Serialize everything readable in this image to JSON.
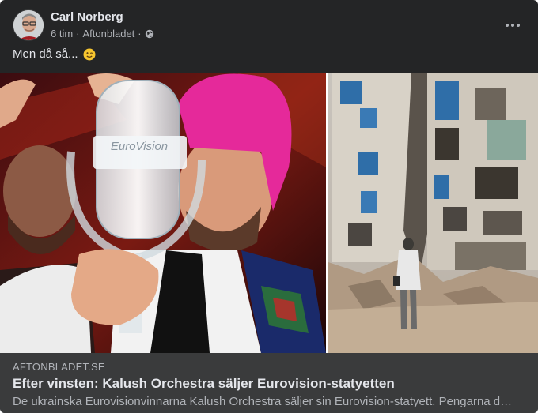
{
  "post": {
    "author": "Carl Norberg",
    "time": "6 tim",
    "source": "Aftonbladet",
    "separator": "·",
    "visibility_icon": "globe-icon",
    "text": "Men då så...",
    "emoji": "winking-face-emoji",
    "more_icon": "more-options-icon"
  },
  "media": {
    "left_image": "eurovision-trophy-photo",
    "right_image": "damaged-building-photo",
    "trophy_logo_text": "EuroVision"
  },
  "link": {
    "domain": "AFTONBLADET.SE",
    "title": "Efter vinsten: Kalush Orchestra säljer Eurovision-statyetten",
    "description": "De ukrainska Eurovisionvinnarna Kalush Orchestra säljer sin Eurovision-statyett. Pengarna d…"
  },
  "colors": {
    "card_bg": "#242526",
    "link_bg": "#3a3b3c",
    "primary_text": "#e4e6eb",
    "secondary_text": "#b0b3b8"
  }
}
